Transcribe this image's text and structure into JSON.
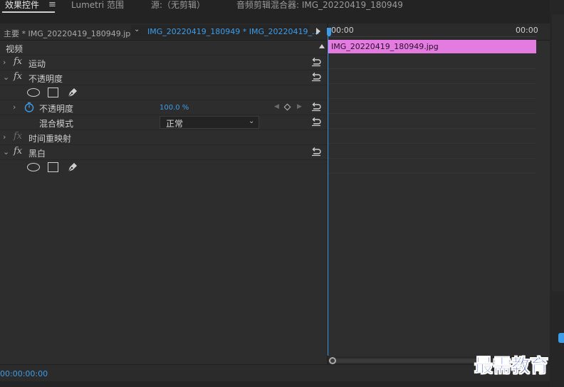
{
  "tabs": [
    {
      "label": "效果控件",
      "active": true
    },
    {
      "label": "Lumetri 范围",
      "active": false
    },
    {
      "label": "源:（无剪辑）",
      "active": false
    },
    {
      "label": "音频剪辑混合器: IMG_20220419_180949",
      "active": false
    }
  ],
  "clip_header": {
    "master_label": "主要 * IMG_20220419_180949.jpg",
    "clip_select": "IMG_20220419_180949 * IMG_20220419_..."
  },
  "section": {
    "title": "视频"
  },
  "effects": {
    "motion": "运动",
    "opacity": "不透明度",
    "opacity_param": "不透明度",
    "opacity_value": "100.0 %",
    "blend_mode_label": "混合模式",
    "blend_mode_value": "正常",
    "time_remap": "时间重映射",
    "black_white": "黑白"
  },
  "timeline": {
    "start_time": "00:00",
    "end_time": "00:00",
    "clip_name": "IMG_20220419_180949.jpg",
    "clip_color": "#e47be0"
  },
  "footer": {
    "timecode": "00:00:00:00"
  },
  "watermark": "最需教育",
  "accent": "#3d9de9"
}
